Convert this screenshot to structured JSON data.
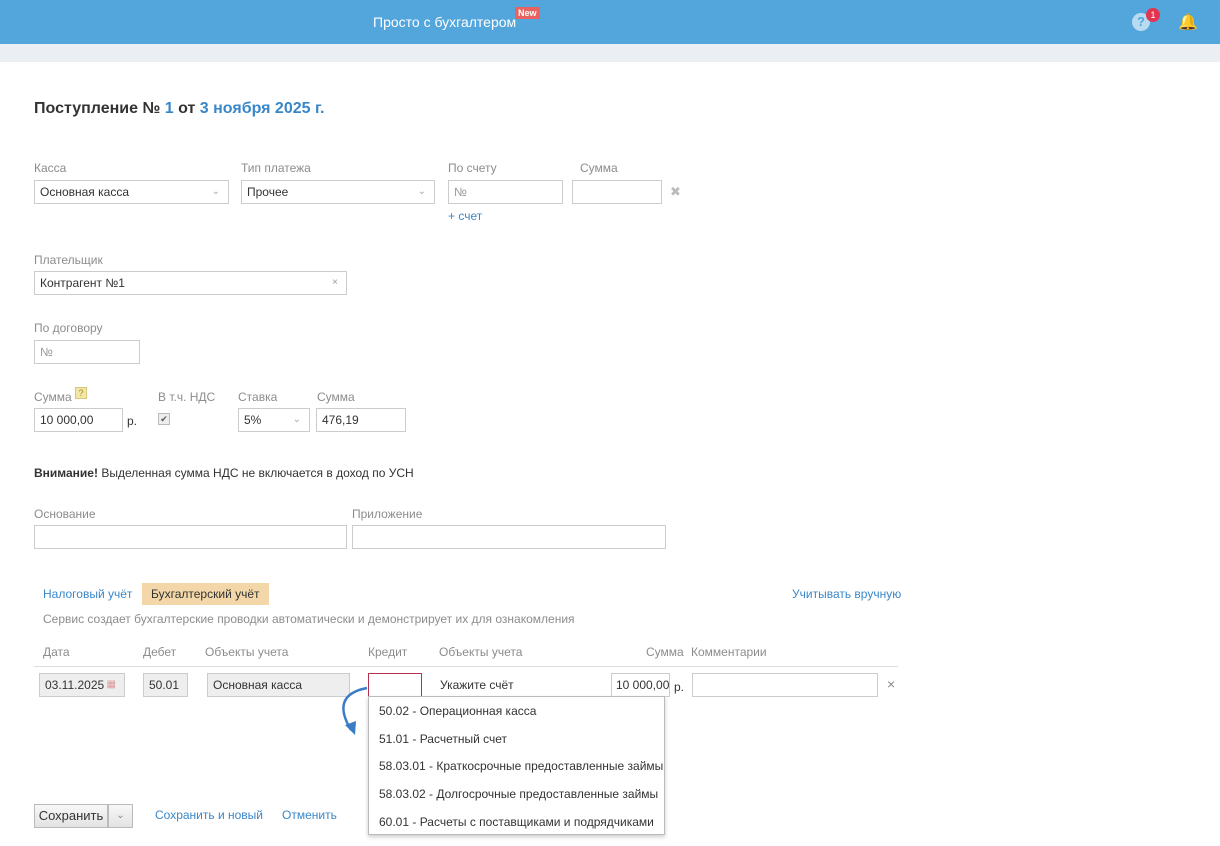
{
  "header": {
    "brand": "Просто с бухгалтером",
    "new_badge": "New",
    "help_icon": "?",
    "help_count": "1"
  },
  "doc": {
    "title_prefix": "Поступление №",
    "number": "1",
    "from": "от",
    "date": "3 ноября 2025 г."
  },
  "form": {
    "kassa_label": "Касса",
    "kassa_value": "Основная касса",
    "payment_type_label": "Тип платежа",
    "payment_type_value": "Прочее",
    "invoice_label": "По счету",
    "invoice_placeholder": "№",
    "add_invoice": "+ счет",
    "sum_label": "Сумма",
    "payer_label": "Плательщик",
    "payer_value": "Контрагент №1",
    "contract_label": "По договору",
    "contract_placeholder": "№",
    "amount_label": "Сумма",
    "amount_help": "?",
    "amount_value": "10 000,00",
    "currency": "р.",
    "vat_incl_label": "В т.ч. НДС",
    "rate_label": "Ставка",
    "rate_value": "5%",
    "vat_sum_label": "Сумма",
    "vat_sum_value": "476,19",
    "warning_bold": "Внимание!",
    "warning_text": "Выделенная сумма НДС не включается в доход по УСН",
    "basis_label": "Основание",
    "attachment_label": "Приложение"
  },
  "accounting": {
    "tab_tax": "Налоговый учёт",
    "tab_accounting": "Бухгалтерский учёт",
    "manual_link": "Учитывать вручную",
    "note": "Сервис создает бухгалтерские проводки автоматически и демонстрирует их для ознакомления",
    "headers": {
      "date": "Дата",
      "debit": "Дебет",
      "objects1": "Объекты учета",
      "credit": "Кредит",
      "objects2": "Объекты учета",
      "sum": "Сумма",
      "comments": "Комментарии"
    },
    "row": {
      "date": "03.11.2025",
      "debit": "50.01",
      "debit_object": "Основная касса",
      "credit": "",
      "credit_hint": "Укажите счёт",
      "sum": "10 000,00",
      "currency": "р."
    },
    "dropdown": [
      "50.02 - Операционная касса",
      "51.01 - Расчетный счет",
      "58.03.01 - Краткосрочные предоставленные займы",
      "58.03.02 - Долгосрочные предоставленные займы",
      "60.01 - Расчеты с поставщиками и подрядчиками"
    ]
  },
  "actions": {
    "save": "Сохранить",
    "save_new": "Сохранить и новый",
    "cancel": "Отменить"
  }
}
